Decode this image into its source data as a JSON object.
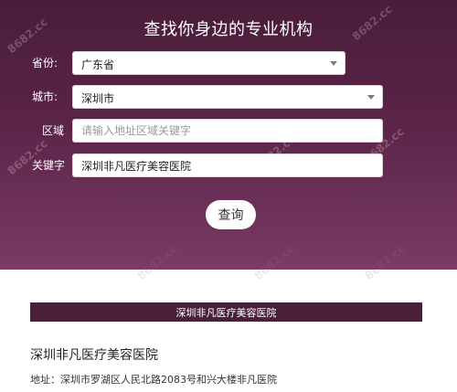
{
  "hero": {
    "title": "查找你身边的专业机构"
  },
  "form": {
    "province": {
      "label": "省份:",
      "value": "广东省"
    },
    "city": {
      "label": "城市:",
      "value": "深圳市"
    },
    "region": {
      "label": "区域",
      "placeholder": "请输入地址区域关键字"
    },
    "keyword": {
      "label": "关键字",
      "value": "深圳非凡医疗美容医院"
    },
    "submit_label": "查询"
  },
  "watermark": {
    "text": "8682.cc"
  },
  "results": {
    "header": "深圳非凡医疗美容医院",
    "name": "深圳非凡医疗美容医院",
    "address": "地址：深圳市罗湖区人民北路2083号和兴大楼非凡医院"
  },
  "colors": {
    "hero_top": "#4a1d3a",
    "hero_bottom": "#7a3a66",
    "result_bar": "#4a1f39"
  }
}
